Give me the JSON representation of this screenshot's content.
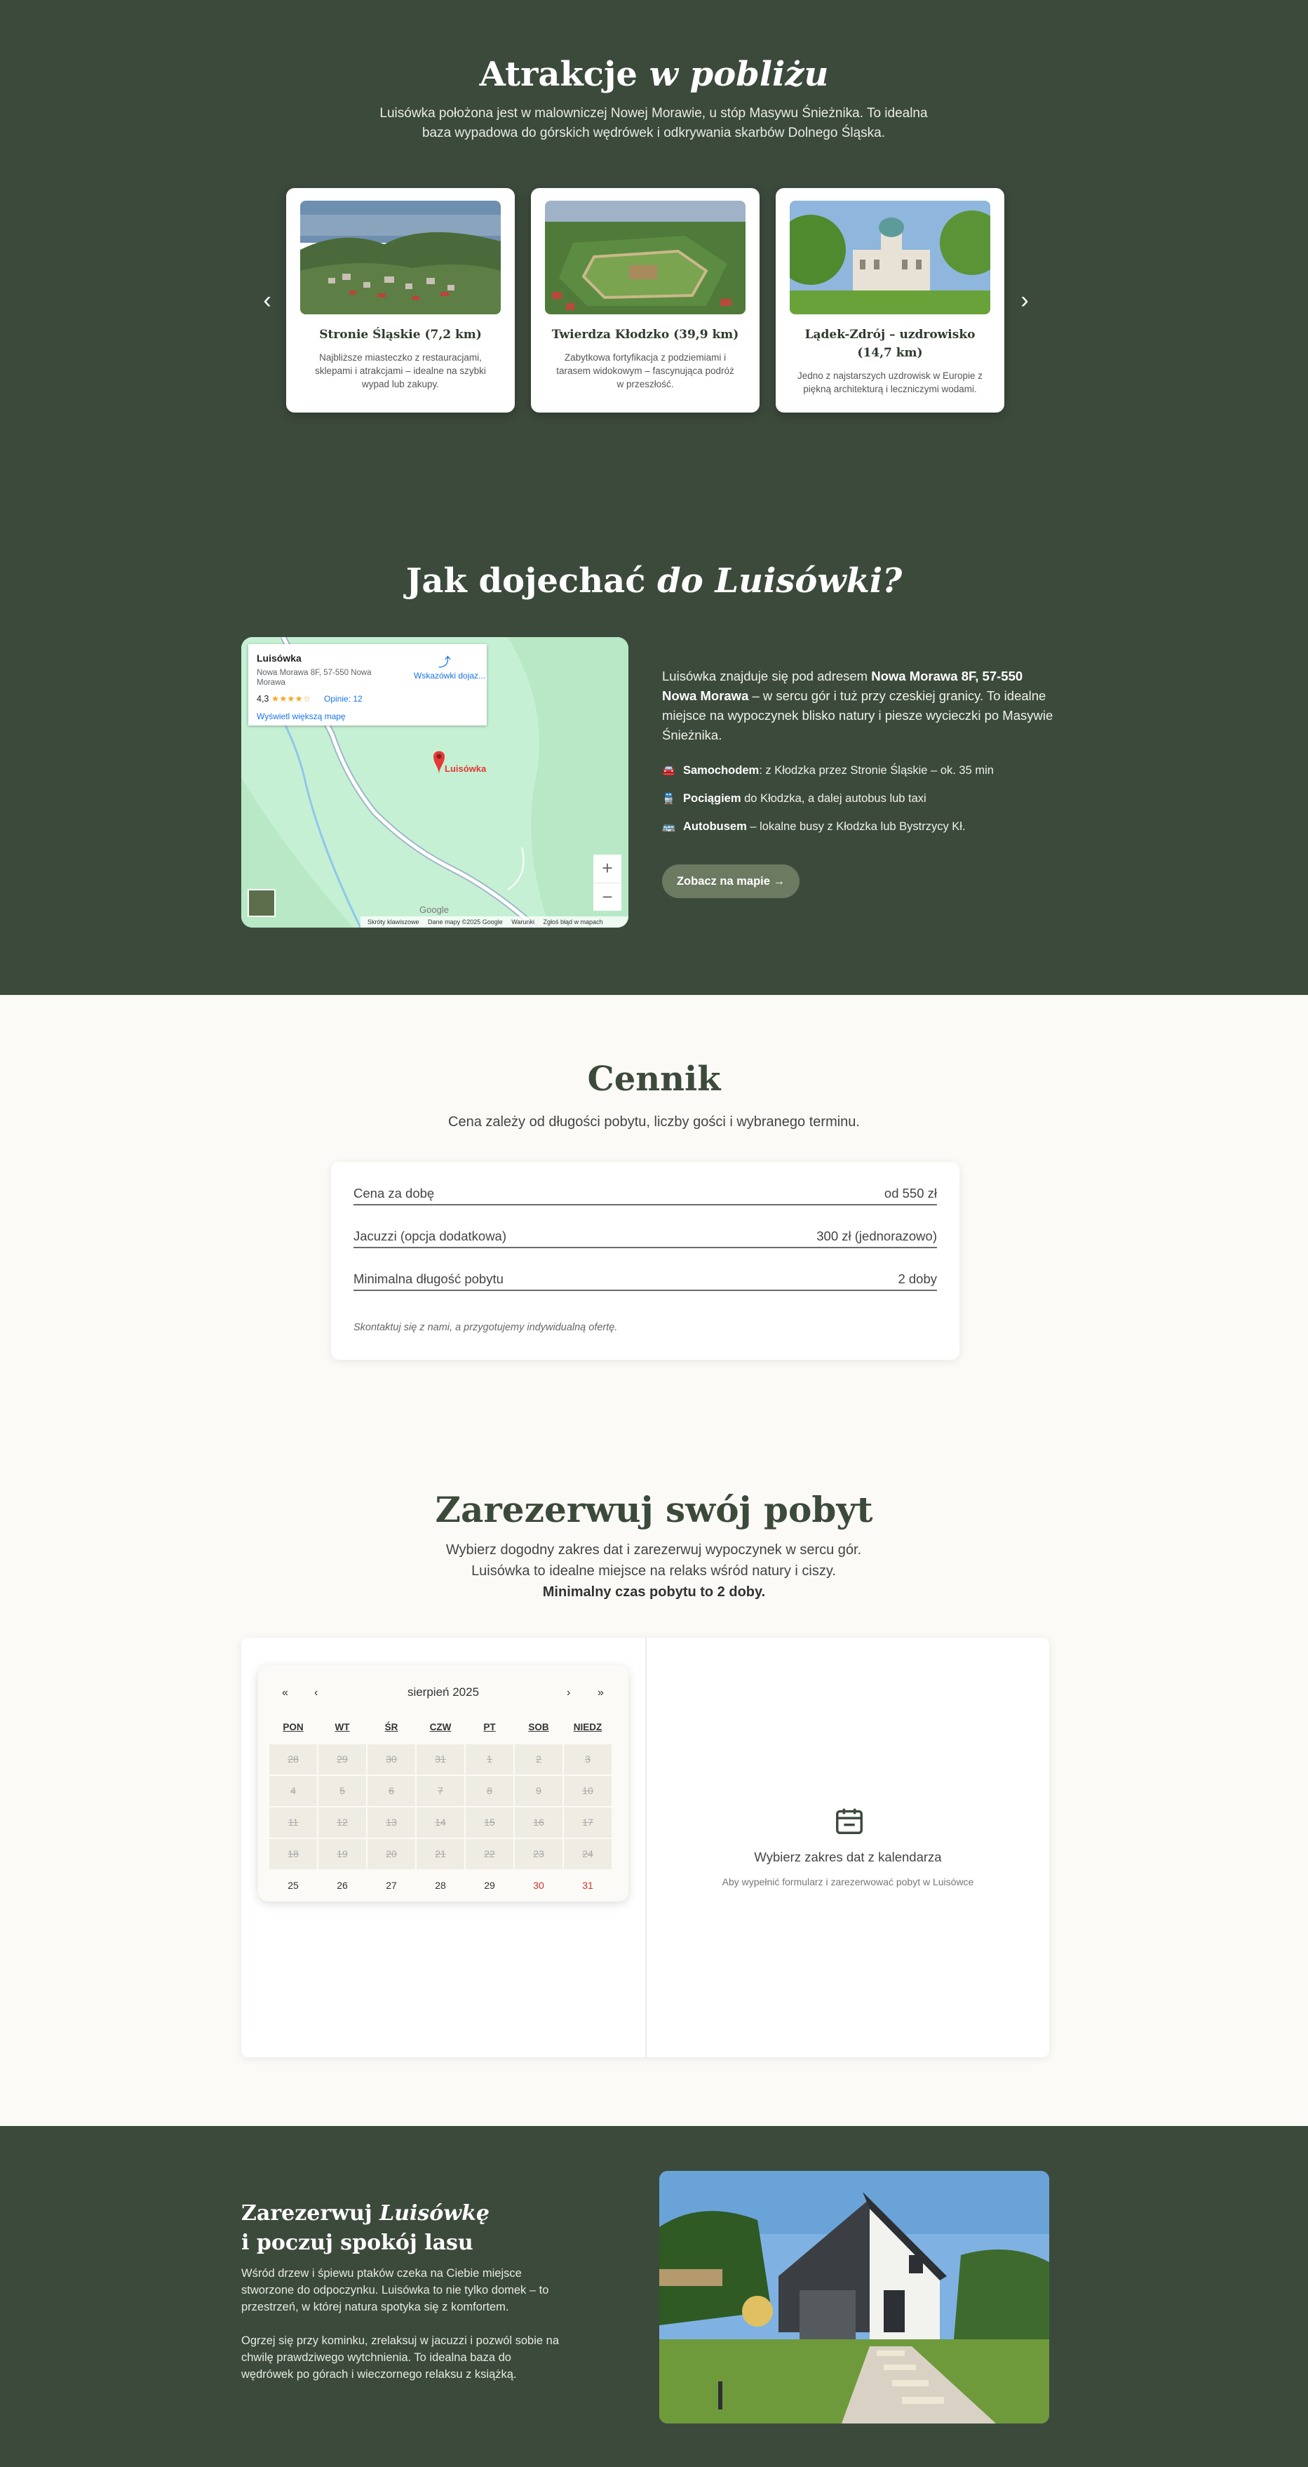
{
  "attractions": {
    "title_main": "Atrakcje",
    "title_em": "w pobliżu",
    "subtitle": "Luisówka położona jest w malowniczej Nowej Morawie, u stóp Masywu Śnieżnika. To idealna baza wypadowa do górskich wędrówek i odkrywania skarbów Dolnego Śląska.",
    "prev_icon": "chevron-left-icon",
    "next_icon": "chevron-right-icon",
    "cards": [
      {
        "title": "Stronie Śląskie (7,2 km)",
        "desc": "Najbliższe miasteczko z restauracjami, sklepami i atrakcjami – idealne na szybki wypad lub zakupy."
      },
      {
        "title": "Twierdza Kłodzko (39,9 km)",
        "desc": "Zabytkowa fortyfikacja z podziemiami i tarasem widokowym – fascynująca podróż w przeszłość."
      },
      {
        "title": "Lądek-Zdrój – uzdrowisko (14,7 km)",
        "desc": "Jedno z najstarszych uzdrowisk w Europie z piękną architekturą i leczniczymi wodami."
      }
    ]
  },
  "directions": {
    "title_main": "Jak dojechać",
    "title_em": "do Luisówki?",
    "map": {
      "place_name": "Luisówka",
      "address": "Nowa Morawa 8F, 57-550 Nowa Morawa",
      "rating": "4,3",
      "stars": "★★★★☆",
      "reviews": "Opinie: 12",
      "directions_label": "Wskazówki dojaz...",
      "larger_map": "Wyświetl większą mapę",
      "pin_label": "Luisówka",
      "zoom_in": "+",
      "zoom_out": "−",
      "google": "Google",
      "footer": [
        "Skróty klawiszowe",
        "Dane mapy ©2025 Google",
        "Warunki",
        "Zgłoś błąd w mapach"
      ]
    },
    "text_pre": "Luisówka znajduje się pod adresem ",
    "text_bold": "Nowa Morawa 8F, 57-550 Nowa Morawa",
    "text_post": " – w sercu gór i tuż przy czeskiej granicy. To idealne miejsce na wypoczynek blisko natury i piesze wycieczki po Masywie Śnieżnika.",
    "transport": [
      {
        "icon": "car-icon",
        "label": "Samochodem",
        "text": ": z Kłodzka przez Stronie Śląskie – ok. 35 min"
      },
      {
        "icon": "train-icon",
        "label": "Pociągiem",
        "text": " do Kłodzka, a dalej autobus lub taxi"
      },
      {
        "icon": "bus-icon",
        "label": "Autobusem",
        "text": " – lokalne busy z Kłodzka lub Bystrzycy Kł."
      }
    ],
    "map_button": "Zobacz na mapie →"
  },
  "pricing": {
    "title": "Cennik",
    "subtitle": "Cena zależy od długości pobytu, liczby gości i wybranego terminu.",
    "rows": [
      {
        "label": "Cena za dobę",
        "value": "od 550 zł"
      },
      {
        "label": "Jacuzzi (opcja dodatkowa)",
        "value": "300 zł (jednorazowo)"
      },
      {
        "label": "Minimalna długość pobytu",
        "value": "2 doby"
      }
    ],
    "note": "Skontaktuj się z nami, a przygotujemy indywidualną ofertę."
  },
  "booking": {
    "title": "Zarezerwuj swój pobyt",
    "subtitle_1": "Wybierz dogodny zakres dat i zarezerwuj wypoczynek w sercu gór.",
    "subtitle_2": "Luisówka to idealne miejsce na relaks wśród natury i ciszy.",
    "min_stay": "Minimalny czas pobytu to 2 doby.",
    "calendar": {
      "month": "sierpień 2025",
      "nav": {
        "prev_year": "«",
        "prev_month": "‹",
        "next_month": "›",
        "next_year": "»"
      },
      "weekdays": [
        "PON",
        "WT",
        "ŚR",
        "CZW",
        "PT",
        "SOB",
        "NIEDZ"
      ],
      "weeks": [
        [
          "28",
          "29",
          "30",
          "31",
          "1",
          "2",
          "3"
        ],
        [
          "4",
          "5",
          "6",
          "7",
          "8",
          "9",
          "10"
        ],
        [
          "11",
          "12",
          "13",
          "14",
          "15",
          "16",
          "17"
        ],
        [
          "18",
          "19",
          "20",
          "21",
          "22",
          "23",
          "24"
        ],
        [
          "25",
          "26",
          "27",
          "28",
          "29",
          "30",
          "31"
        ]
      ]
    },
    "empty_icon": "calendar-icon",
    "empty_title": "Wybierz zakres dat z kalendarza",
    "empty_sub": "Aby wypełnić formularz i zarezerwować pobyt w Luisówce"
  },
  "footer": {
    "title_1": "Zarezerwuj ",
    "title_em": "Luisówkę",
    "title_2": "i poczuj spokój lasu",
    "p1": "Wśród drzew i śpiewu ptaków czeka na Ciebie miejsce stworzone do odpoczynku. Luisówka to nie tylko domek – to przestrzeń, w której natura spotyka się z komfortem.",
    "p2": "Ogrzej się przy kominku, zrelaksuj w jacuzzi i pozwól sobie na chwilę prawdziwego wytchnienia. To idealna baza do wędrówek po górach i wieczornego relaksu z książką."
  },
  "colors": {
    "dark_green": "#3c4a3c",
    "cream": "#fbfaf6",
    "button_green": "#6d7a62",
    "weekend_red": "#d0312d"
  }
}
